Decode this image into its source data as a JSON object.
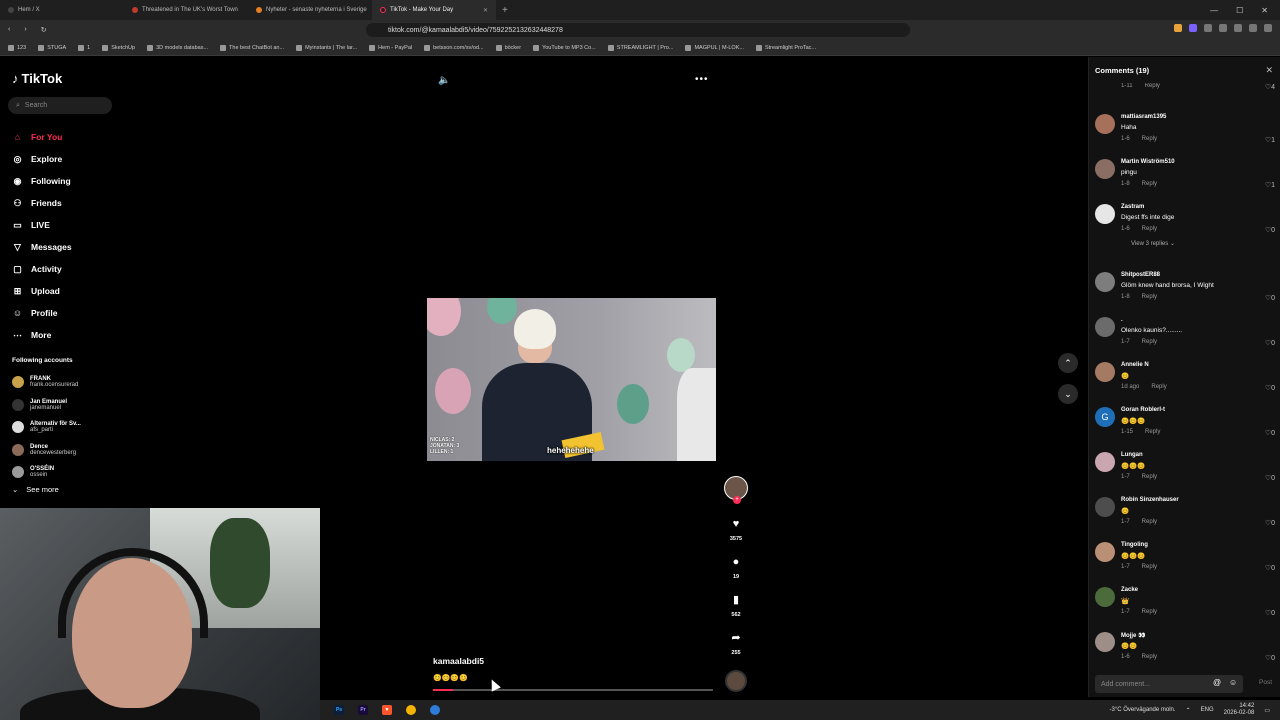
{
  "browser": {
    "tabs": [
      {
        "label": "Hem / X"
      },
      {
        "label": "Threatened in The UK's Worst Town"
      },
      {
        "label": "Nyheter - senaste nyheterna i Sverige"
      },
      {
        "label": "TikTok - Make Your Day"
      }
    ],
    "url": "tiktok.com/@kamaalabdi5/video/7592252132632448278",
    "bookmarks": [
      "123",
      "STUGA",
      "1",
      "SketchUp",
      "3D models databas...",
      "The best ChatBot an...",
      "Myinstants | The lar...",
      "Hem - PayPal",
      "betsson.com/sv/od...",
      "böcker",
      "YouTube to MP3 Co...",
      "STREAMLIGHT | Pro...",
      "MAGPUL | M-LOK...",
      "Streamlight ProTac..."
    ]
  },
  "sidebar": {
    "logo": "TikTok",
    "search_placeholder": "Search",
    "nav": [
      {
        "label": "For You",
        "icon": "home-icon"
      },
      {
        "label": "Explore",
        "icon": "compass-icon"
      },
      {
        "label": "Following",
        "icon": "following-icon"
      },
      {
        "label": "Friends",
        "icon": "friends-icon"
      },
      {
        "label": "LIVE",
        "icon": "live-icon"
      },
      {
        "label": "Messages",
        "icon": "send-icon"
      },
      {
        "label": "Activity",
        "icon": "activity-icon"
      },
      {
        "label": "Upload",
        "icon": "plus-icon"
      },
      {
        "label": "Profile",
        "icon": "profile-icon"
      },
      {
        "label": "More",
        "icon": "more-icon"
      }
    ],
    "following_title": "Following accounts",
    "following": [
      {
        "name": "FRANK",
        "user": "frank.ocensurerad"
      },
      {
        "name": "Jan Emanuel",
        "user": "janemanuel"
      },
      {
        "name": "Alternativ för Sv...",
        "user": "afs_parti"
      },
      {
        "name": "Dence",
        "user": "dencewesterberg"
      },
      {
        "name": "O'SSÉIN",
        "user": "ossein"
      }
    ],
    "see_more": "See more"
  },
  "video": {
    "caption": "hehehehehe",
    "score": [
      "NICLAS: 2",
      "JONATAN: 3",
      "LILLEN: 1"
    ],
    "author": "kamaalabdi5",
    "description": "😊😊😊😊",
    "progress": 0.07,
    "likes": "3575",
    "comments": "19",
    "saves": "562",
    "shares": "255"
  },
  "comments": {
    "title": "Comments (19)",
    "reply_label": "Reply",
    "items": [
      {
        "name": "",
        "text": "",
        "date": "1-11",
        "likes": "4"
      },
      {
        "name": "mattiasram1395",
        "text": "Haha",
        "date": "1-6",
        "likes": "1"
      },
      {
        "name": "Martin Wiström510",
        "text": "pingu",
        "date": "1-8",
        "likes": "1"
      },
      {
        "name": "Zastram",
        "text": "Digest ffs inte dige",
        "date": "1-6",
        "likes": "0",
        "replies": "View 3 replies"
      },
      {
        "name": "ShitpostER88",
        "text": "Glöm knew hand brorsa, I Wight",
        "date": "1-8",
        "likes": "0"
      },
      {
        "name": ".",
        "text": "Olenko kaunis?.........",
        "date": "1-7",
        "likes": "0"
      },
      {
        "name": "Annelie N",
        "text": "😊",
        "date": "1d ago",
        "likes": "0"
      },
      {
        "name": "Goran Roblerl-t",
        "text": "😊😊😊",
        "date": "1-15",
        "likes": "0"
      },
      {
        "name": "Lungan",
        "text": "😊😊😊",
        "date": "1-7",
        "likes": "0"
      },
      {
        "name": "Robin Sinzenhauser",
        "text": "😊",
        "date": "1-7",
        "likes": "0"
      },
      {
        "name": "Tingoling",
        "text": "😊😊😊",
        "date": "1-7",
        "likes": "0"
      },
      {
        "name": "Zacke",
        "text": "👑",
        "date": "1-7",
        "likes": "0"
      },
      {
        "name": "Mojje 👀",
        "text": "😊😊",
        "date": "1-6",
        "likes": "0"
      }
    ],
    "input_placeholder": "Add comment...",
    "post_label": "Post"
  },
  "taskbar": {
    "weather": "-3°C  Övervägande moln.",
    "lang": "ENG",
    "time": "14:42",
    "date": "2026-02-08"
  }
}
